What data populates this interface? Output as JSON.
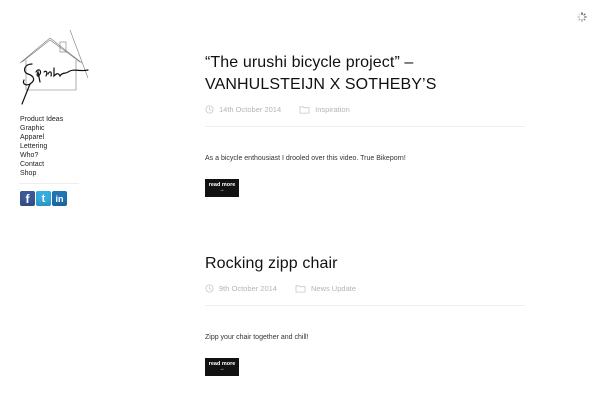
{
  "nav": {
    "items": [
      "Product Ideas",
      "Graphic",
      "Apparel",
      "Lettering",
      "Who?",
      "Contact",
      "Shop"
    ]
  },
  "social": {
    "facebook": "f",
    "twitter": "t",
    "linkedin": "in"
  },
  "posts": [
    {
      "title_line1": "“The urushi bicycle project” –",
      "title_line2": "VANHULSTEIJN X SOTHEBY’S",
      "date": "14th October 2014",
      "category": "Inspiration",
      "excerpt": "As a bicycle enthousiast I drooled over this video. True Bikeporn!",
      "read_more": "read more →"
    },
    {
      "title_line1": "Rocking zipp chair",
      "date": "9th October 2014",
      "category": "News Update",
      "excerpt": "Zipp your chair together and chill!",
      "read_more": "read more →"
    }
  ],
  "colors": {
    "accent": "#111111",
    "meta_text": "#b5b5b5",
    "facebook": "#3b5998",
    "twitter": "#33aee3",
    "linkedin": "#1f76b7"
  },
  "icons": [
    "spinner-icon",
    "clock-icon",
    "folder-icon",
    "facebook-icon",
    "twitter-icon",
    "linkedin-icon"
  ]
}
